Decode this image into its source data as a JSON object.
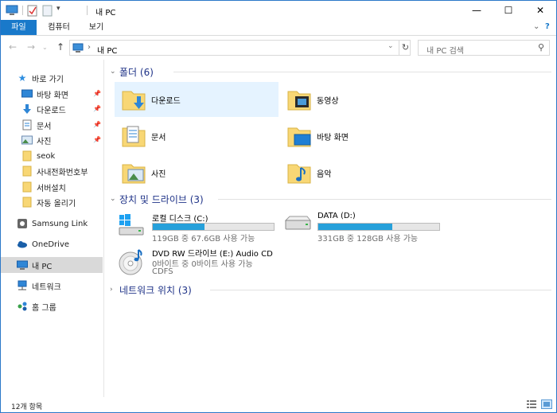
{
  "window": {
    "title": "내 PC"
  },
  "caption": {
    "minimize": "—",
    "maximize": "☐",
    "close": "✕"
  },
  "ribbon": {
    "tabs": [
      {
        "label": "파일"
      },
      {
        "label": "컴퓨터"
      },
      {
        "label": "보기"
      }
    ]
  },
  "address": {
    "path": "내 PC",
    "search_placeholder": "내 PC 검색"
  },
  "nav": {
    "quick_access": "바로 가기",
    "items": [
      {
        "label": "바탕 화면",
        "pinned": true
      },
      {
        "label": "다운로드",
        "pinned": true
      },
      {
        "label": "문서",
        "pinned": true
      },
      {
        "label": "사진",
        "pinned": true
      },
      {
        "label": "seok",
        "pinned": false
      },
      {
        "label": "사내전화번호부",
        "pinned": false
      },
      {
        "label": "서버설치",
        "pinned": false
      },
      {
        "label": "자동 올리기",
        "pinned": false
      }
    ],
    "samsung_link": "Samsung Link",
    "onedrive": "OneDrive",
    "this_pc": "내 PC",
    "network": "네트워크",
    "homegroup": "홈 그룹"
  },
  "groups": {
    "folders": {
      "title": "폴더 (6)"
    },
    "drives": {
      "title": "장치 및 드라이브 (3)"
    },
    "network_locations": {
      "title": "네트워크 위치 (3)"
    }
  },
  "folders": [
    {
      "label": "다운로드",
      "icon": "downloads-folder-icon"
    },
    {
      "label": "동영상",
      "icon": "videos-folder-icon"
    },
    {
      "label": "문서",
      "icon": "documents-folder-icon"
    },
    {
      "label": "바탕 화면",
      "icon": "desktop-folder-icon"
    },
    {
      "label": "사진",
      "icon": "pictures-folder-icon"
    },
    {
      "label": "음악",
      "icon": "music-folder-icon"
    }
  ],
  "drives": [
    {
      "name": "로컬 디스크 (C:)",
      "free": "119GB 중 67.6GB 사용 가능",
      "used_fraction": 0.43
    },
    {
      "name": "DATA (D:)",
      "free": "331GB 중 128GB 사용 가능",
      "used_fraction": 0.61
    },
    {
      "name": "DVD RW 드라이브 (E:) Audio CD",
      "free": "0바이트 중 0바이트 사용 가능",
      "fs": "CDFS"
    }
  ],
  "status": {
    "count": "12개 항목"
  },
  "colors": {
    "accent": "#1979ca",
    "bar_fill": "#26a0da",
    "group_title": "#1e3287",
    "selected_bg": "#e5f3ff"
  }
}
